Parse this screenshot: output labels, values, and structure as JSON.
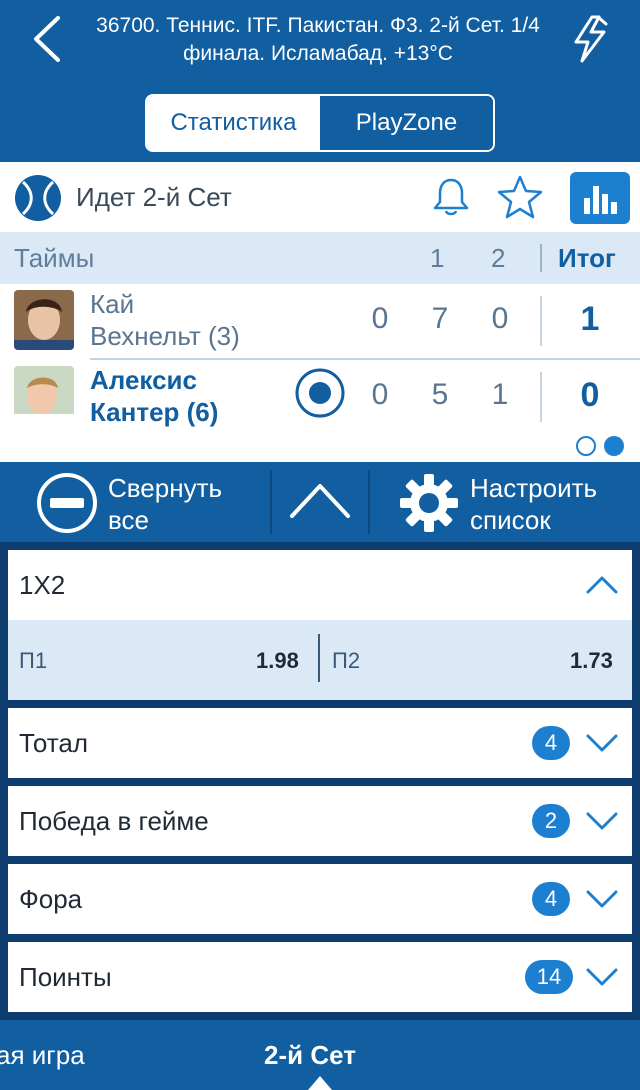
{
  "header": {
    "title": "36700. Теннис. ITF. Пакистан. Ф3. 2-й Сет. 1/4 финала. Исламабад. +13°C",
    "back_icon": "chevron-left-icon",
    "action_icon": "lightning-icon",
    "tabs": [
      {
        "label": "Статистика",
        "active": true
      },
      {
        "label": "PlayZone",
        "active": false
      }
    ]
  },
  "status": {
    "sport_icon": "tennis-ball-icon",
    "text": "Идет 2-й  Сет",
    "icons": [
      "bell-icon",
      "star-icon",
      "bar-chart-icon"
    ]
  },
  "periods": {
    "label": "Таймы",
    "cols": [
      "1",
      "2"
    ],
    "total_label": "Итог"
  },
  "players": [
    {
      "name_line1": "Кай",
      "name_line2": "Вехнельт (3)",
      "scores": [
        "0",
        "7",
        "0"
      ],
      "total": "1",
      "serving": false
    },
    {
      "name_line1": "Алексис",
      "name_line2": "Кантер (6)",
      "scores": [
        "0",
        "5",
        "1"
      ],
      "total": "0",
      "serving": true
    }
  ],
  "toolbar": {
    "collapse_line1": "Свернуть",
    "collapse_line2": "все",
    "configure_line1": "Настроить",
    "configure_line2": "список"
  },
  "markets": [
    {
      "title": "1X2",
      "expanded": true,
      "odds": [
        {
          "label": "П1",
          "value": "1.98"
        },
        {
          "label": "П2",
          "value": "1.73"
        }
      ]
    },
    {
      "title": "Тотал",
      "count": "4"
    },
    {
      "title": "Победа в гейме",
      "count": "2"
    },
    {
      "title": "Фора",
      "count": "4"
    },
    {
      "title": "Поинты",
      "count": "14"
    }
  ],
  "bottom_tabs": {
    "left": "ая игра",
    "active": "2-й  Сет"
  },
  "colors": {
    "primary": "#115ea0",
    "accent": "#1d7fd0",
    "light": "#dbe9f6"
  }
}
